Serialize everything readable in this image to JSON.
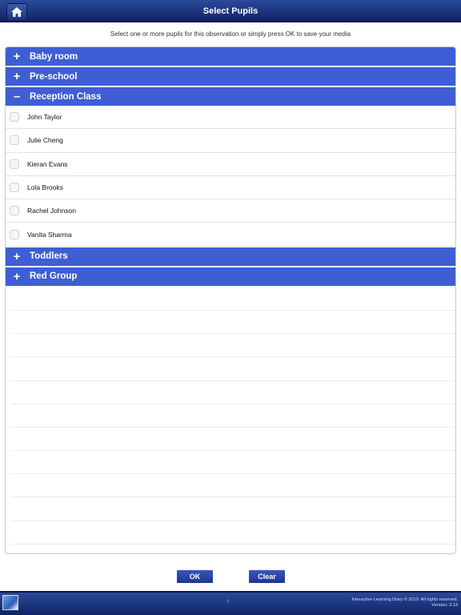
{
  "header": {
    "title": "Select Pupils",
    "home_icon": "home-icon"
  },
  "instruction": "Select one or more pupils for this observation or simply press OK to save your media",
  "groups_top": [
    {
      "label": "Baby room",
      "sign": "+"
    },
    {
      "label": "Pre-school",
      "sign": "+"
    }
  ],
  "expanded_group": {
    "label": "Reception Class",
    "sign": "–",
    "pupils": [
      "John Taylor",
      "Julie Cheng",
      "Kieran Evans",
      "Lola Brooks",
      "Rachel Johnson",
      "Vanita Sharma"
    ]
  },
  "groups_bottom": [
    {
      "label": "Toddlers",
      "sign": "+"
    },
    {
      "label": "Red Group",
      "sign": "+"
    }
  ],
  "buttons": {
    "ok": "OK",
    "clear": "Clear"
  },
  "footer": {
    "info": "i",
    "copyright": "Interactive Learning Diary © 2019. All rights reserved.",
    "version": "Version: 3.13"
  },
  "colors": {
    "accent": "#3f5ed4",
    "bar": "#1b347a"
  }
}
